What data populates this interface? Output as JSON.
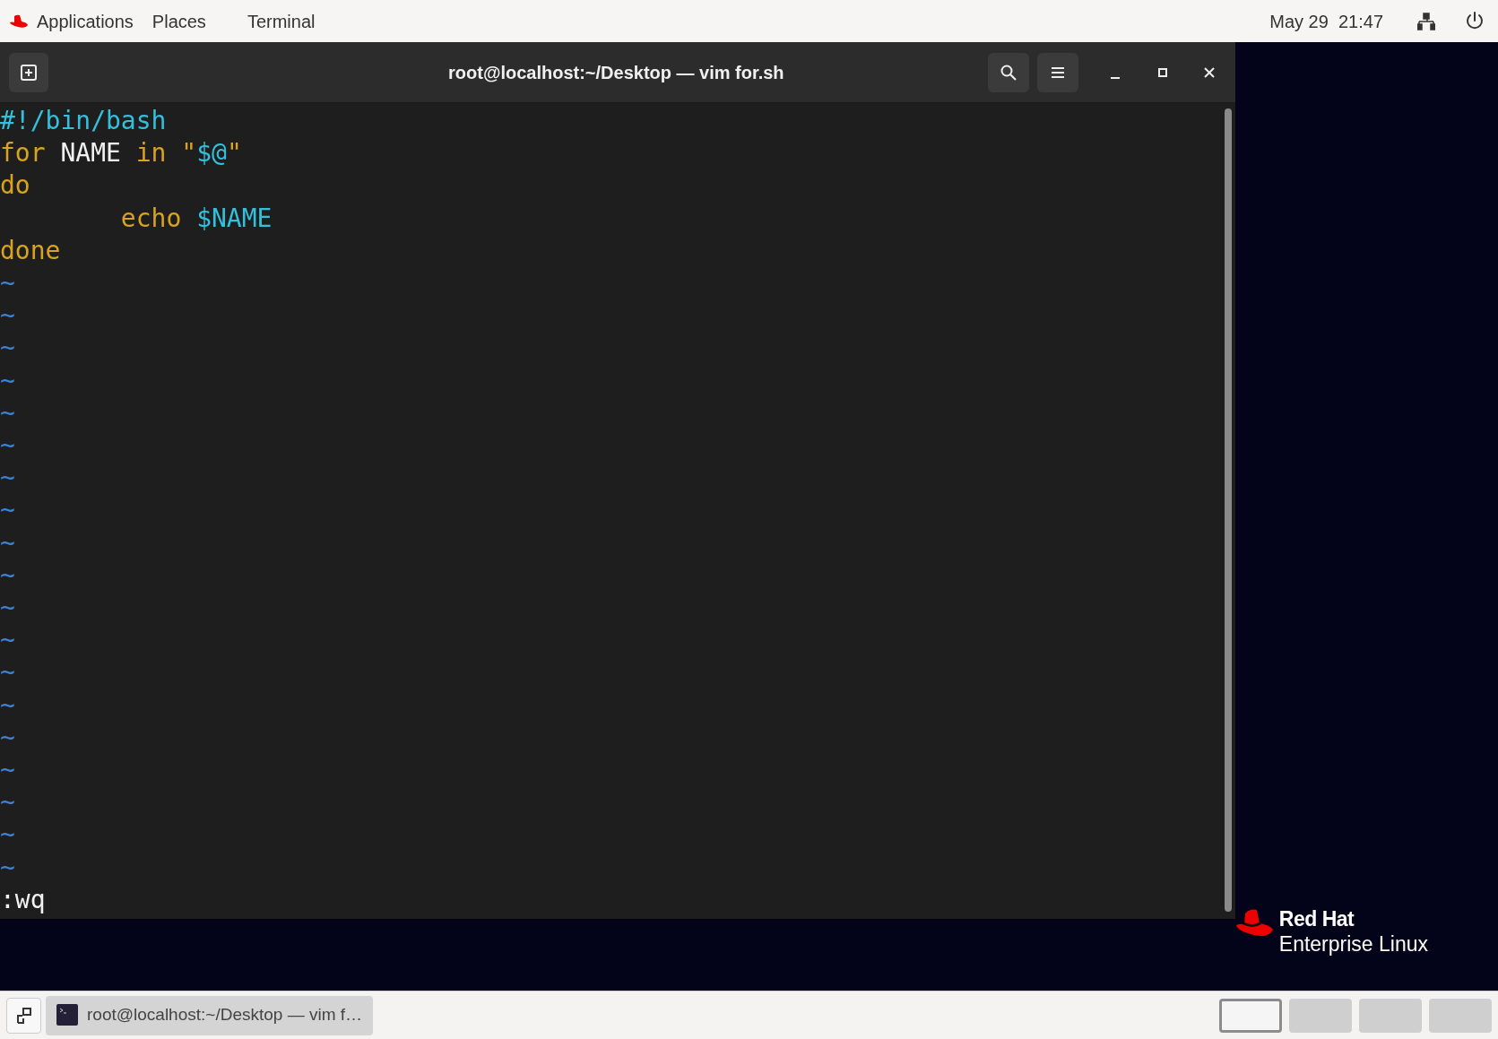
{
  "top_bar": {
    "activities": "Applications",
    "places": "Places",
    "app_menu": "Terminal",
    "clock": "May 29  21:47"
  },
  "window": {
    "title": "root@localhost:~/Desktop — vim for.sh"
  },
  "editor": {
    "lines": [
      {
        "indent": false,
        "tokens": [
          {
            "text": "#!/bin/bash",
            "kind": "special"
          }
        ]
      },
      {
        "indent": false,
        "tokens": [
          {
            "text": "for",
            "kind": "keyword"
          },
          {
            "text": " NAME ",
            "kind": "plain"
          },
          {
            "text": "in",
            "kind": "keyword"
          },
          {
            "text": " \"",
            "kind": "keyword"
          },
          {
            "text": "$@",
            "kind": "special"
          },
          {
            "text": "\"",
            "kind": "keyword"
          }
        ]
      },
      {
        "indent": false,
        "tokens": [
          {
            "text": "do",
            "kind": "keyword"
          }
        ]
      },
      {
        "indent": true,
        "tokens": [
          {
            "text": "echo ",
            "kind": "keyword"
          },
          {
            "text": "$NAME",
            "kind": "special"
          }
        ]
      },
      {
        "indent": false,
        "tokens": [
          {
            "text": "done",
            "kind": "keyword"
          }
        ]
      }
    ],
    "filler": [
      "~",
      "~",
      "~",
      "~",
      "~",
      "~",
      "~",
      "~",
      "~",
      "~",
      "~",
      "~",
      "~",
      "~",
      "~",
      "~",
      "~",
      "~",
      "~"
    ],
    "command_line": ":wq"
  },
  "brand": {
    "name": "Red Hat",
    "product": "Enterprise Linux"
  },
  "taskbar": {
    "task": "root@localhost:~/Desktop — vim f…",
    "workspaces": [
      {
        "selected": true
      },
      {
        "selected": false
      },
      {
        "selected": false
      },
      {
        "selected": false
      }
    ]
  }
}
